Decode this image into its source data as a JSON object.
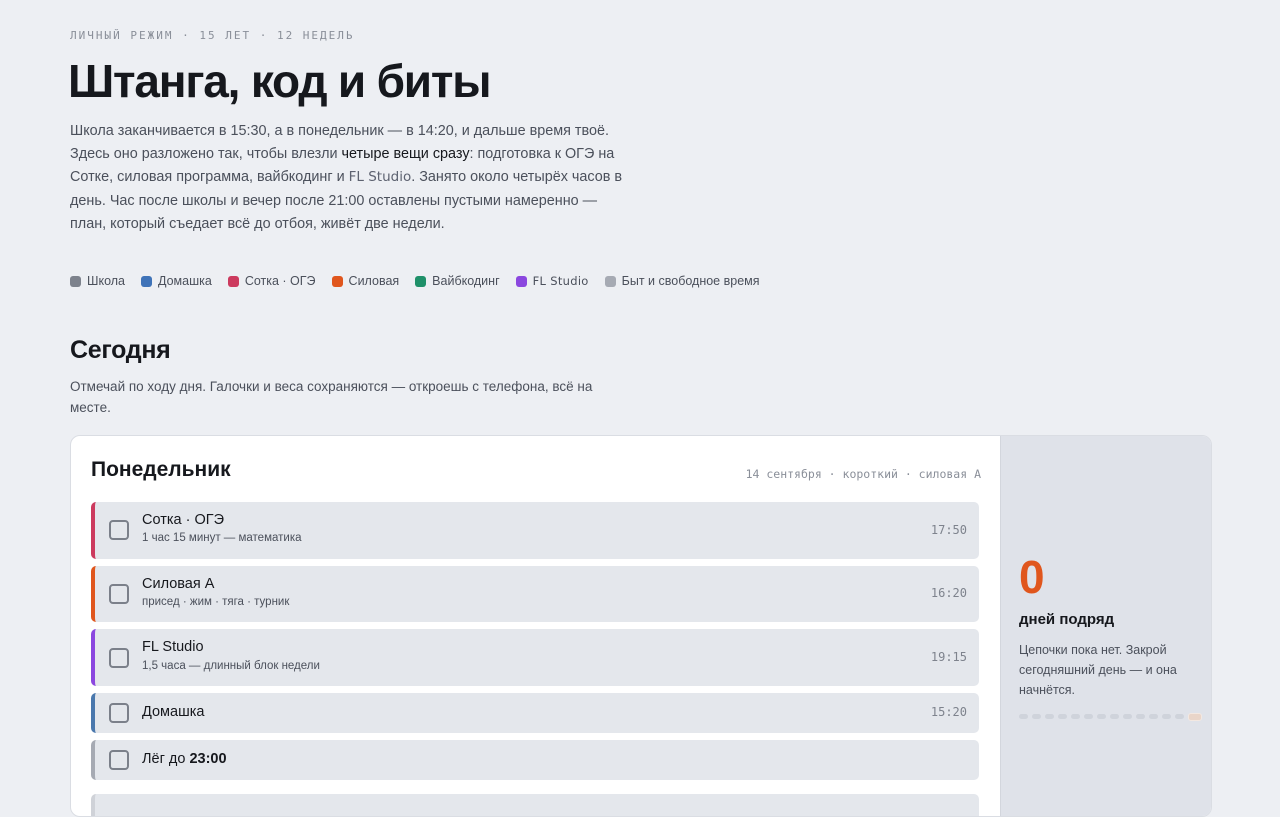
{
  "header": {
    "kicker": "ЛИЧНЫЙ РЕЖИМ · 15 ЛЕТ · 12 НЕДЕЛЬ",
    "title": "Штанга, код и биты",
    "intro_1": "Школа заканчивается в 15:30, а в понедельник — в 14:20, и дальше время твоё. Здесь оно разложено так, чтобы влезли ",
    "intro_strong": "четыре вещи сразу",
    "intro_2": ": подготовка к ОГЭ на Сотке, силовая программа, вайбкодинг и ",
    "intro_mono": "FL Studio",
    "intro_3": ". Занято около четырёх часов в день. Час после школы и вечер после 21:00 оставлены пустыми намеренно — план, который съедает всё до отбоя, живёт две недели."
  },
  "legend": [
    {
      "label": "Школа",
      "color": "#7d828c"
    },
    {
      "label": "Домашка",
      "color": "#3f73b8"
    },
    {
      "label": "Сотка · ОГЭ",
      "color": "#cc3a5e"
    },
    {
      "label": "Силовая",
      "color": "#e0561d"
    },
    {
      "label": "Вайбкодинг",
      "color": "#1f9069"
    },
    {
      "label": "FL Studio",
      "color": "#8b47df"
    },
    {
      "label": "Быт и свободное время",
      "color": "#a6aab3"
    }
  ],
  "today": {
    "title": "Сегодня",
    "subtitle": "Отмечай по ходу дня. Галочки и веса сохраняются — откроешь с телефона, всё на месте.",
    "day_name": "Понедельник",
    "day_meta": "14 сентября · короткий · силовая А",
    "tasks": [
      {
        "title": "Сотка · ОГЭ",
        "sub": "1 час 15 минут — математика",
        "time": "17:50",
        "checked": false
      },
      {
        "title": "Силовая А",
        "sub": "присед · жим · тяга · турник",
        "time": "16:20",
        "checked": false
      },
      {
        "title": "FL Studio",
        "sub": "1,5 часа — длинный блок недели",
        "time": "19:15",
        "checked": false
      },
      {
        "title": "Домашка",
        "sub": "",
        "time": "15:20",
        "checked": false
      },
      {
        "title_prefix": "Лёг до ",
        "title_bold": "23:00",
        "sub": "",
        "time": "",
        "checked": false
      }
    ]
  },
  "streak": {
    "count": "0",
    "label": "дней подряд",
    "text": "Цепочки пока нет. Закрой сегодняшний день — и она начнётся."
  }
}
